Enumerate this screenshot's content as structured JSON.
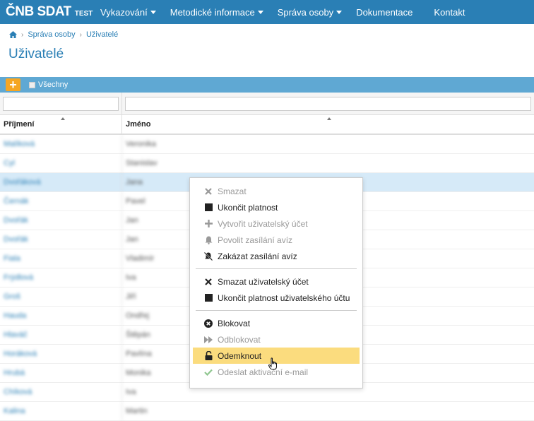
{
  "brand": {
    "main": "ČNB SDAT",
    "sub": "TEST"
  },
  "nav": [
    {
      "label": "Vykazování",
      "dropdown": true
    },
    {
      "label": "Metodické informace",
      "dropdown": true
    },
    {
      "label": "Správa osoby",
      "dropdown": true
    },
    {
      "label": "Dokumentace",
      "dropdown": false
    },
    {
      "label": "Kontakt",
      "dropdown": false
    }
  ],
  "breadcrumb": {
    "level1": "Správa osoby",
    "level2": "Uživatelé"
  },
  "page_title": "Uživatelé",
  "toolbar": {
    "add_label": "+",
    "filter_label": "Všechny"
  },
  "table": {
    "headers": {
      "surname": "Příjmení",
      "name": "Jméno"
    },
    "filters": {
      "surname": "",
      "name": ""
    },
    "rows": [
      {
        "surname": "Malíková",
        "name": "Veronika"
      },
      {
        "surname": "Cyl",
        "name": "Stanislav"
      },
      {
        "surname": "Dvořáková",
        "name": "Jana"
      },
      {
        "surname": "Černák",
        "name": "Pavel"
      },
      {
        "surname": "Dvořák",
        "name": "Jan"
      },
      {
        "surname": "Dvořák",
        "name": "Jan"
      },
      {
        "surname": "Fiala",
        "name": "Vladimír"
      },
      {
        "surname": "Frýdlová",
        "name": "Iva"
      },
      {
        "surname": "Groš",
        "name": "Jiří"
      },
      {
        "surname": "Hauda",
        "name": "Ondřej"
      },
      {
        "surname": "Hlaváč",
        "name": "Štěpán"
      },
      {
        "surname": "Horáková",
        "name": "Pavlína"
      },
      {
        "surname": "Hrubá",
        "name": "Monika"
      },
      {
        "surname": "Chíková",
        "name": "Iva"
      },
      {
        "surname": "Kalina",
        "name": "Martin"
      }
    ],
    "selected_row": 2
  },
  "context_menu": {
    "group1": [
      {
        "label": "Smazat",
        "icon": "x-icon",
        "disabled": true
      },
      {
        "label": "Ukončit platnost",
        "icon": "square-icon",
        "disabled": false
      },
      {
        "label": "Vytvořit uživatelský účet",
        "icon": "plus-icon",
        "disabled": true
      },
      {
        "label": "Povolit zasílání avíz",
        "icon": "bell-icon",
        "disabled": true
      },
      {
        "label": "Zakázat zasílání avíz",
        "icon": "bell-slash-icon",
        "disabled": false
      }
    ],
    "group2": [
      {
        "label": "Smazat uživatelský účet",
        "icon": "x-icon",
        "disabled": false
      },
      {
        "label": "Ukončit platnost uživatelského účtu",
        "icon": "square-icon",
        "disabled": false
      }
    ],
    "group3": [
      {
        "label": "Blokovat",
        "icon": "x-circle-icon",
        "disabled": false
      },
      {
        "label": "Odblokovat",
        "icon": "fast-forward-icon",
        "disabled": true
      },
      {
        "label": "Odemknout",
        "icon": "unlock-icon",
        "disabled": false,
        "active": true
      },
      {
        "label": "Odeslat aktivační e-mail",
        "icon": "check-icon",
        "disabled": true
      }
    ]
  },
  "colors": {
    "nav_bg": "#2a7fb5",
    "toolbar_bg": "#5fa8d3",
    "accent": "#f5a623",
    "highlight": "#fbdc7e",
    "selected_row": "#d6eaf8"
  }
}
